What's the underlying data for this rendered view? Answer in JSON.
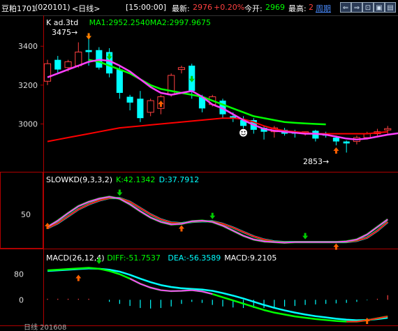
{
  "header": {
    "instrument": "豆粕1701",
    "code": "(020101)",
    "period": "<日线>",
    "time": "[15:00:00]",
    "latest_label": "最新:",
    "latest": "2976",
    "change": "+0.20%",
    "open_label": "今开:",
    "open": "2969",
    "high_label": "最高:",
    "high": "2",
    "week_label": "周期",
    "buttons": [
      "⇐",
      "⇒",
      "⊡",
      "▣",
      "▤"
    ]
  },
  "colors": {
    "up": "#ff4040",
    "down": "#00ffff",
    "ma1": "#ff40ff",
    "ma2": "#00ff00",
    "ma3": "#ff0000",
    "k_line": "#ff40ff",
    "d_line": "#ff0000",
    "diff": "#00ffff",
    "dea": "#00ff00"
  },
  "chart_data": [
    {
      "type": "candlestick",
      "title": "K  ad.3td",
      "legend": [
        {
          "text": "K  ad.3td",
          "color": "#ffffff"
        },
        {
          "text": "MA1:2952.2540",
          "color": "#00ff00"
        },
        {
          "text": "MA2:2997.9675",
          "color": "#00ff00"
        }
      ],
      "y_ticks": [
        3400,
        3200,
        3000
      ],
      "ylim": [
        2790,
        3530
      ],
      "annotations": [
        {
          "text": "3475→",
          "value": 3475
        },
        {
          "text": "2853→",
          "value": 2853
        }
      ],
      "candles": [
        {
          "o": 3220,
          "c": 3310,
          "h": 3330,
          "l": 3200
        },
        {
          "o": 3330,
          "c": 3280,
          "h": 3350,
          "l": 3260
        },
        {
          "o": 3290,
          "c": 3320,
          "h": 3330,
          "l": 3270
        },
        {
          "o": 3300,
          "c": 3370,
          "h": 3420,
          "l": 3290
        },
        {
          "o": 3380,
          "c": 3370,
          "h": 3460,
          "l": 3300
        },
        {
          "o": 3380,
          "c": 3290,
          "h": 3395,
          "l": 3280
        },
        {
          "o": 3370,
          "c": 3260,
          "h": 3390,
          "l": 3240
        },
        {
          "o": 3280,
          "c": 3160,
          "h": 3300,
          "l": 3130
        },
        {
          "o": 3140,
          "c": 3110,
          "h": 3150,
          "l": 3070
        },
        {
          "o": 3130,
          "c": 3030,
          "h": 3170,
          "l": 3010
        },
        {
          "o": 3060,
          "c": 3120,
          "h": 3130,
          "l": 3040
        },
        {
          "o": 3080,
          "c": 3140,
          "h": 3150,
          "l": 3050
        },
        {
          "o": 3150,
          "c": 3250,
          "h": 3260,
          "l": 3140
        },
        {
          "o": 3280,
          "c": 3290,
          "h": 3300,
          "l": 3260
        },
        {
          "o": 3300,
          "c": 3170,
          "h": 3310,
          "l": 3130
        },
        {
          "o": 3140,
          "c": 3080,
          "h": 3150,
          "l": 3060
        },
        {
          "o": 3100,
          "c": 3140,
          "h": 3150,
          "l": 3090
        },
        {
          "o": 3120,
          "c": 3050,
          "h": 3130,
          "l": 3030
        },
        {
          "o": 3040,
          "c": 3030,
          "h": 3060,
          "l": 3010
        },
        {
          "o": 3020,
          "c": 2990,
          "h": 3040,
          "l": 2970
        },
        {
          "o": 3020,
          "c": 2970,
          "h": 3030,
          "l": 2950
        },
        {
          "o": 2980,
          "c": 2960,
          "h": 2990,
          "l": 2920
        },
        {
          "o": 2960,
          "c": 2980,
          "h": 2990,
          "l": 2930
        },
        {
          "o": 2970,
          "c": 2950,
          "h": 2980,
          "l": 2940
        },
        {
          "o": 2960,
          "c": 2950,
          "h": 2970,
          "l": 2930
        },
        {
          "o": 2950,
          "c": 2960,
          "h": 2960,
          "l": 2940
        },
        {
          "o": 2965,
          "c": 2925,
          "h": 2970,
          "l": 2910
        },
        {
          "o": 2950,
          "c": 2940,
          "h": 2960,
          "l": 2930
        },
        {
          "o": 2930,
          "c": 2910,
          "h": 2940,
          "l": 2890
        },
        {
          "o": 2910,
          "c": 2900,
          "h": 2915,
          "l": 2853
        },
        {
          "o": 2910,
          "c": 2930,
          "h": 2940,
          "l": 2895
        },
        {
          "o": 2930,
          "c": 2950,
          "h": 2960,
          "l": 2920
        },
        {
          "o": 2950,
          "c": 2960,
          "h": 2975,
          "l": 2940
        },
        {
          "o": 2969,
          "c": 2976,
          "h": 2990,
          "l": 2950
        }
      ],
      "ma1": [
        3240,
        3260,
        3280,
        3300,
        3320,
        3330,
        3325,
        3300,
        3270,
        3230,
        3190,
        3160,
        3150,
        3160,
        3170,
        3140,
        3100,
        3080,
        3050,
        3020,
        2995,
        2975,
        2965,
        2960,
        2955,
        2950,
        2950,
        2945,
        2935,
        2925,
        2920,
        2925,
        2935,
        2945,
        2952
      ],
      "ma2": [
        3330,
        3320,
        3300,
        3280,
        3260,
        3230,
        3200,
        3180,
        3170,
        3160,
        3150,
        3140,
        3120,
        3100,
        3080,
        3060,
        3040,
        3030,
        3020,
        3010,
        3006,
        3003,
        3000,
        2998
      ],
      "ma3": [
        2910,
        2920,
        2930,
        2940,
        2950,
        2960,
        2970,
        2980,
        2985,
        2990,
        2995,
        3000,
        3005,
        3010,
        3015,
        3020,
        3025,
        3030,
        3030,
        3025,
        3010,
        2990,
        2975,
        2965,
        2960,
        2955,
        2950,
        2950,
        2950,
        2950,
        2950,
        2950,
        2955,
        2960
      ]
    },
    {
      "type": "line",
      "title": "SLOWKD(9,3,3,2)",
      "legend": [
        {
          "text": "SLOWKD(9,3,3,2)",
          "color": "#ffffff"
        },
        {
          "text": "K:42.1342",
          "color": "#00ff00"
        },
        {
          "text": "D:37.7912",
          "color": "#00ffff"
        }
      ],
      "y_ticks": [
        50
      ],
      "ylim": [
        0,
        100
      ],
      "series": [
        {
          "name": "K",
          "values": [
            30,
            40,
            52,
            63,
            70,
            75,
            78,
            75,
            66,
            55,
            45,
            38,
            34,
            35,
            39,
            40,
            38,
            32,
            24,
            16,
            10,
            7,
            6,
            5,
            6,
            6,
            6,
            6,
            6,
            7,
            10,
            18,
            30,
            42
          ]
        },
        {
          "name": "D",
          "values": [
            28,
            36,
            47,
            58,
            66,
            72,
            76,
            76,
            70,
            60,
            50,
            42,
            37,
            36,
            38,
            39,
            39,
            35,
            29,
            22,
            15,
            10,
            7,
            6,
            6,
            6,
            6,
            6,
            6,
            6,
            8,
            13,
            24,
            38
          ]
        }
      ]
    },
    {
      "type": "line",
      "title": "MACD(26,12,4)",
      "legend": [
        {
          "text": "MACD(26,12,4)",
          "color": "#ffffff"
        },
        {
          "text": "DIFF:-51.7537",
          "color": "#00ff00"
        },
        {
          "text": "DEA:-56.3589",
          "color": "#00ffff"
        },
        {
          "text": "MACD:9.2105",
          "color": "#ffffff"
        }
      ],
      "y_ticks": [
        80,
        0
      ],
      "ylim": [
        -80,
        125
      ],
      "series": [
        {
          "name": "DIFF",
          "values": [
            92,
            94,
            96,
            98,
            100,
            97,
            90,
            80,
            66,
            50,
            38,
            30,
            27,
            28,
            30,
            26,
            18,
            8,
            -2,
            -12,
            -22,
            -32,
            -40,
            -46,
            -52,
            -56,
            -60,
            -63,
            -66,
            -68,
            -68,
            -64,
            -58,
            -52
          ]
        },
        {
          "name": "DEA",
          "values": [
            90,
            92,
            94,
            96,
            98,
            97,
            94,
            88,
            78,
            66,
            55,
            46,
            40,
            36,
            34,
            32,
            28,
            21,
            13,
            4,
            -6,
            -16,
            -25,
            -33,
            -40,
            -46,
            -51,
            -55,
            -59,
            -62,
            -64,
            -63,
            -60,
            -56
          ]
        },
        {
          "name": "MACD",
          "values": [
            2,
            2,
            2,
            2,
            2,
            0,
            -4,
            -8,
            -12,
            -16,
            -17,
            -16,
            -13,
            -8,
            -4,
            -6,
            -10,
            -13,
            -15,
            -16,
            -16,
            -16,
            -15,
            -13,
            -12,
            -10,
            -9,
            -8,
            -7,
            -6,
            -4,
            -1,
            2,
            9
          ]
        }
      ]
    }
  ],
  "footer": {
    "text": "日线  201608"
  }
}
